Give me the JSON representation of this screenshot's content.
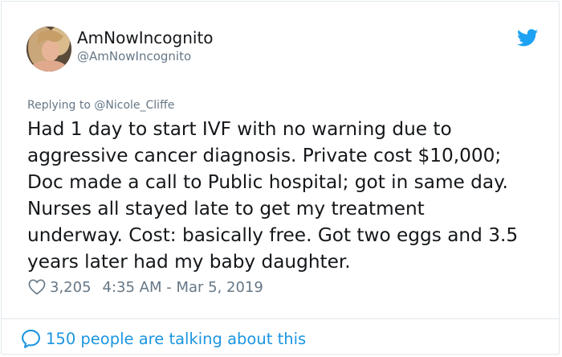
{
  "author": {
    "display_name": "AmNowIncognito",
    "handle": "@AmNowIncognito"
  },
  "reply": {
    "prefix": "Replying to ",
    "mention": "@Nicole_Cliffe"
  },
  "tweet": {
    "lines": [
      "Had 1 day to start IVF with no warning due to",
      "aggressive cancer diagnosis. Private cost $10,000;",
      "Doc made a call to Public hospital; got in same day.",
      "Nurses all stayed late to get my treatment",
      "underway. Cost: basically free. Got two eggs and 3.5",
      "years later had my baby daughter."
    ]
  },
  "meta": {
    "likes": "3,205",
    "timestamp": "4:35 AM - Mar 5, 2019"
  },
  "footer": {
    "conversation": "150 people are talking about this"
  },
  "icons": {
    "brand": "twitter-bird-icon",
    "like": "heart-icon",
    "conversation": "speech-bubble-icon"
  },
  "colors": {
    "twitter_blue": "#1da1f2",
    "link_blue": "#1b95e0",
    "secondary_text": "#657786",
    "primary_text": "#14171a",
    "border": "#e1e8ed"
  }
}
